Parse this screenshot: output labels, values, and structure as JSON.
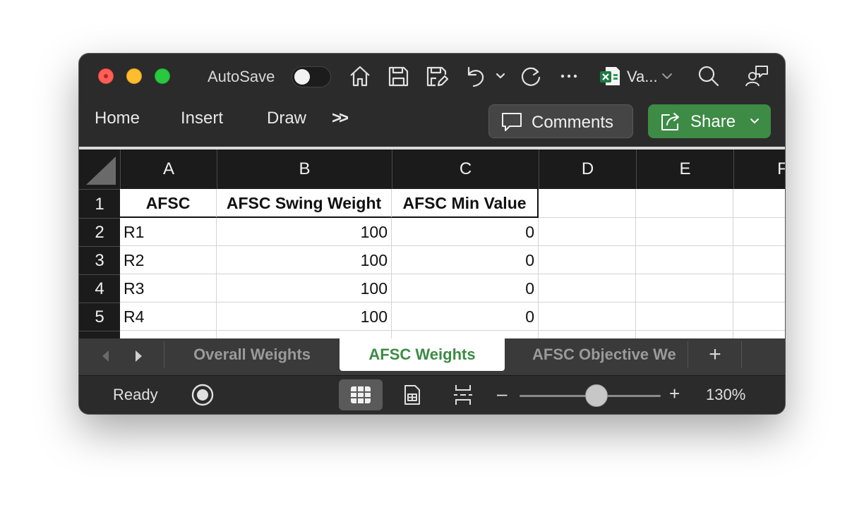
{
  "titlebar": {
    "autosave_label": "AutoSave",
    "doc_name": "Va...",
    "icons": [
      "home-icon",
      "save-icon",
      "save-as-icon",
      "undo-icon",
      "chevron-down-icon",
      "redo-icon",
      "more-icon",
      "excel-file-icon",
      "search-icon",
      "collaborate-icon"
    ]
  },
  "ribbon": {
    "tabs": [
      "Home",
      "Insert",
      "Draw"
    ],
    "more_label": ">>",
    "comments_label": "Comments",
    "share_label": "Share"
  },
  "sheet": {
    "columns": [
      "A",
      "B",
      "C",
      "D",
      "E",
      "F"
    ],
    "rows": [
      "1",
      "2",
      "3",
      "4",
      "5"
    ],
    "header_cells": [
      "AFSC",
      "AFSC Swing Weight",
      "AFSC Min Value"
    ],
    "data_rows": [
      [
        "R1",
        "100",
        "0"
      ],
      [
        "R2",
        "100",
        "0"
      ],
      [
        "R3",
        "100",
        "0"
      ],
      [
        "R4",
        "100",
        "0"
      ]
    ]
  },
  "sheet_tabs": {
    "tabs": [
      "Overall Weights",
      "AFSC Weights",
      "AFSC Objective We"
    ],
    "active": "AFSC Weights",
    "add_label": "+"
  },
  "status": {
    "ready": "Ready",
    "zoom_minus": "–",
    "zoom_plus": "+",
    "zoom_percent": "130%",
    "zoom_level": 130
  },
  "colors": {
    "accent": "#3d8b45",
    "window_bg": "#2b2b2b",
    "header_bg": "#1b1b1b"
  }
}
